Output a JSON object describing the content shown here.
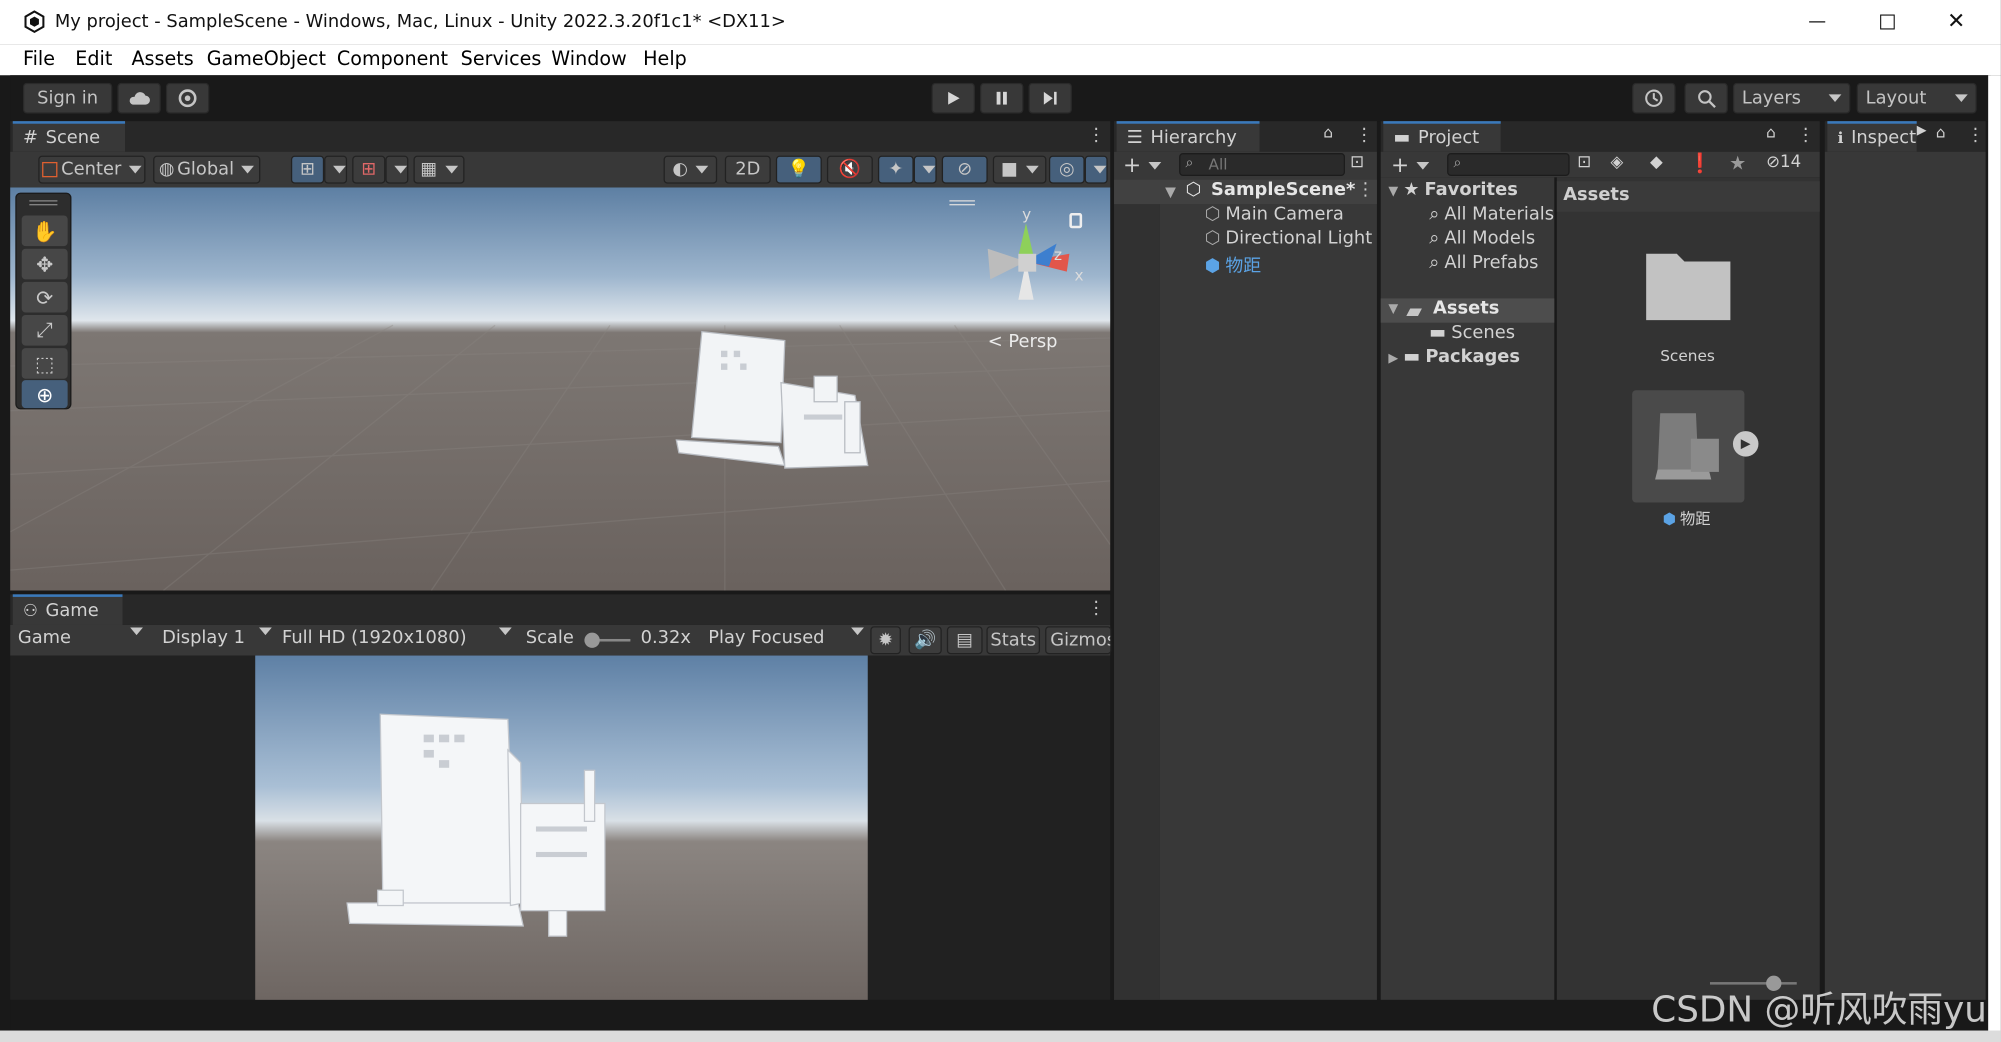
{
  "window": {
    "title": "My project - SampleScene - Windows, Mac, Linux - Unity 2022.3.20f1c1* <DX11>",
    "controls": [
      "—",
      "☐",
      "✕"
    ]
  },
  "menu": [
    "File",
    "Edit",
    "Assets",
    "GameObject",
    "Component",
    "Services",
    "Window",
    "Help"
  ],
  "toolbar": {
    "sign_in": "Sign in",
    "layers": "Layers",
    "layout": "Layout"
  },
  "scene": {
    "tab": "Scene",
    "pivot": "Center",
    "space": "Global",
    "mode_2d": "2D",
    "persp": "Persp",
    "gizmo_y": "y",
    "gizmo_x": "x",
    "gizmo_z": "z"
  },
  "game": {
    "tab": "Game",
    "view": "Game",
    "display": "Display 1",
    "resolution": "Full HD (1920x1080)",
    "scale_label": "Scale",
    "scale_value": "0.32x",
    "play_mode": "Play Focused",
    "stats": "Stats",
    "gizmos": "Gizmos"
  },
  "hierarchy": {
    "tab": "Hierarchy",
    "search_placeholder": "All",
    "scene": "SampleScene*",
    "items": [
      "Main Camera",
      "Directional Light",
      "物距"
    ]
  },
  "project": {
    "tab": "Project",
    "hidden_count": "14",
    "favorites_label": "Favorites",
    "favorites": [
      "All Materials",
      "All Models",
      "All Prefabs"
    ],
    "assets_label": "Assets",
    "assets_children": [
      "Scenes"
    ],
    "packages_label": "Packages",
    "breadcrumb": "Assets",
    "grid": [
      {
        "name": "Scenes",
        "type": "folder"
      },
      {
        "name": "物距",
        "type": "prefab"
      }
    ]
  },
  "inspector": {
    "tab": "Inspector"
  },
  "watermark": "CSDN @听风吹雨yu",
  "colors": {
    "accent": "#3a79bb",
    "panel_bg": "#383838",
    "toolbar_bg": "#191919",
    "selected_blue": "#5ba3e5"
  }
}
